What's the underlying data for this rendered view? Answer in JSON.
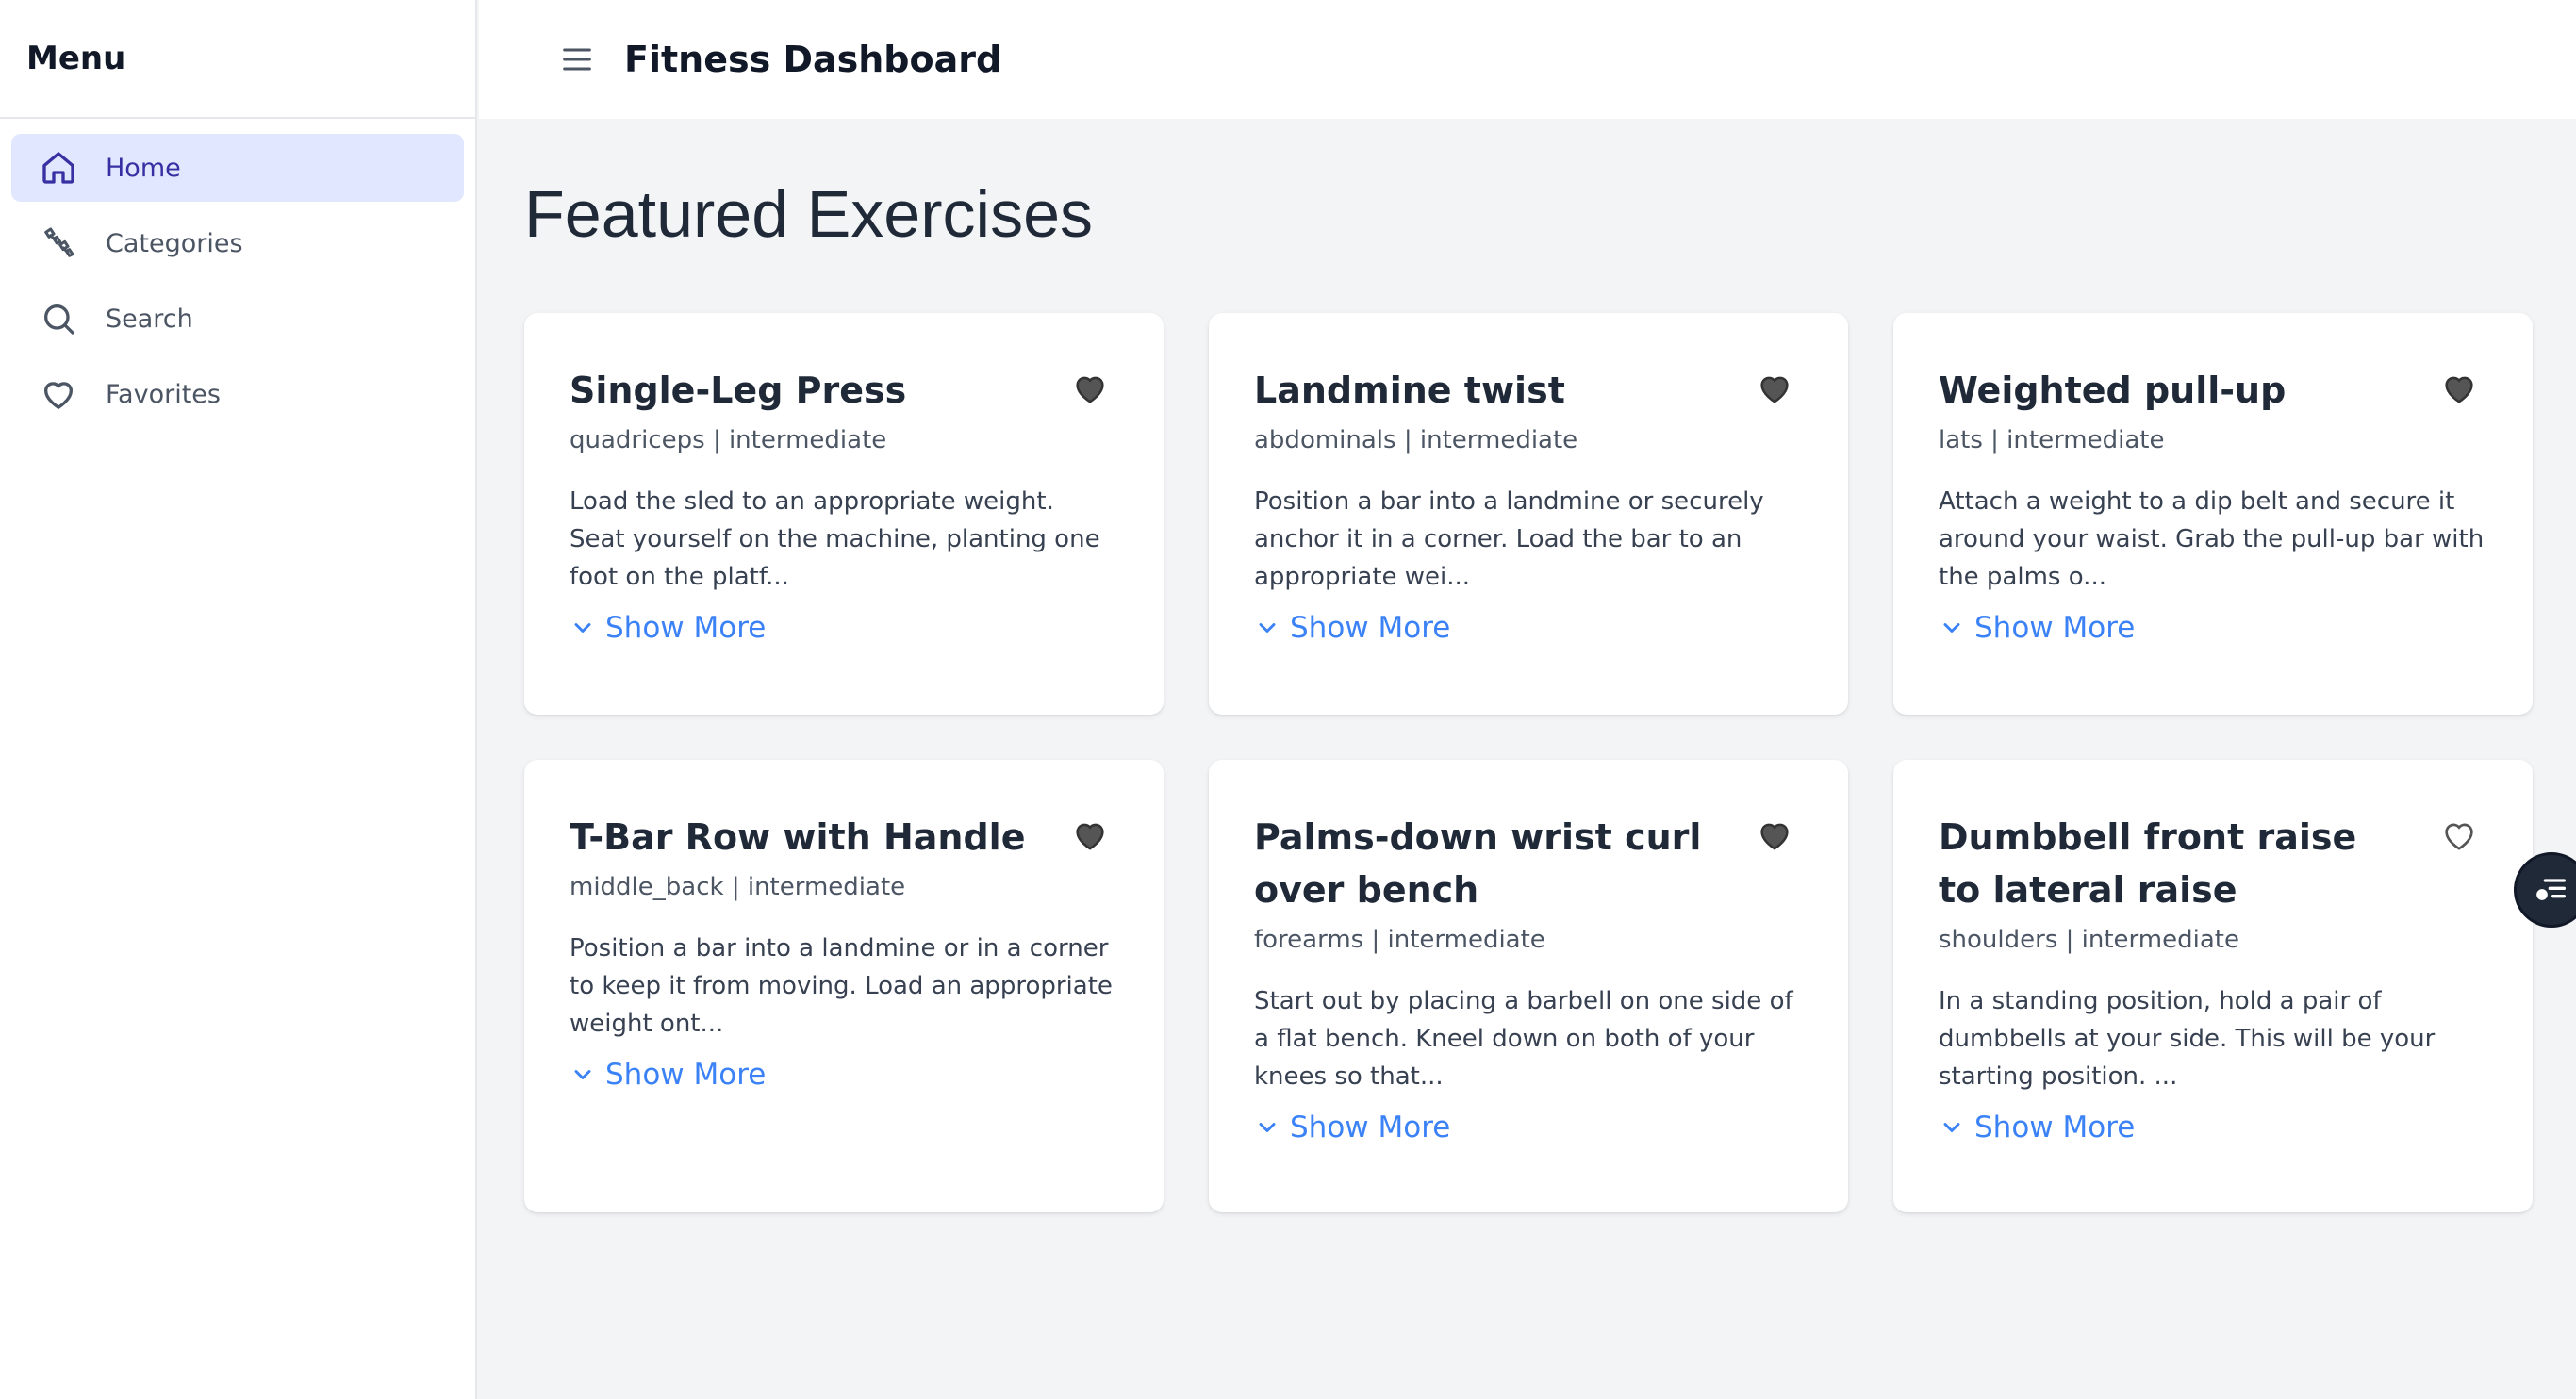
{
  "sidebar": {
    "title": "Menu",
    "items": [
      {
        "label": "Home",
        "icon": "home-icon"
      },
      {
        "label": "Categories",
        "icon": "dumbbell-icon"
      },
      {
        "label": "Search",
        "icon": "search-icon"
      },
      {
        "label": "Favorites",
        "icon": "heart-icon"
      }
    ]
  },
  "header": {
    "title": "Fitness Dashboard"
  },
  "main": {
    "title": "Featured Exercises",
    "show_more_label": "Show More",
    "cards": [
      {
        "title": "Single-Leg Press",
        "meta": "quadriceps | intermediate",
        "description": "Load the sled to an appropriate weight. Seat yourself on the machine, planting one foot on the platf...",
        "favorited": true
      },
      {
        "title": "Landmine twist",
        "meta": "abdominals | intermediate",
        "description": "Position a bar into a landmine or securely anchor it in a corner. Load the bar to an appropriate wei...",
        "favorited": true
      },
      {
        "title": "Weighted pull-up",
        "meta": "lats | intermediate",
        "description": "Attach a weight to a dip belt and secure it around your waist. Grab the pull-up bar with the palms o...",
        "favorited": true
      },
      {
        "title": "T-Bar Row with Handle",
        "meta": "middle_back | intermediate",
        "description": "Position a bar into a landmine or in a corner to keep it from moving. Load an appropriate weight ont...",
        "favorited": true
      },
      {
        "title": "Palms-down wrist curl over bench",
        "meta": "forearms | intermediate",
        "description": "Start out by placing a barbell on one side of a flat bench. Kneel down on both of your knees so that...",
        "favorited": true
      },
      {
        "title": "Dumbbell front raise to lateral raise",
        "meta": "shoulders | intermediate",
        "description": "In a standing position, hold a pair of dumbbells at your side. This will be your starting position. ...",
        "favorited": false
      }
    ]
  },
  "colors": {
    "accent": "#3b82f6",
    "active_nav_bg": "#e0e7ff",
    "active_nav_text": "#3730a3",
    "heart_filled": "#4b4b4b"
  }
}
